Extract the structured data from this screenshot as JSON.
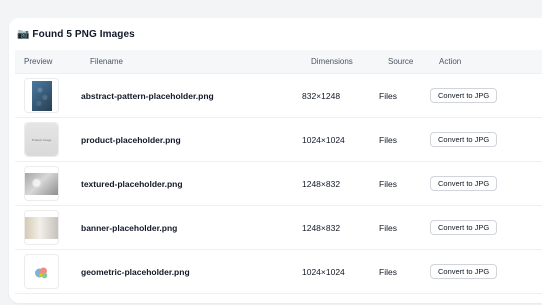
{
  "header": {
    "title": "📷 Found 5 PNG Images"
  },
  "table": {
    "columns": [
      "Preview",
      "Filename",
      "Dimensions",
      "Source",
      "Action"
    ],
    "rows": [
      {
        "preview_icon": "abstract-pattern-thumbnail",
        "filename": "abstract-pattern-placeholder.png",
        "dimensions": "832×1248",
        "source": "Files",
        "action": "Convert to JPG"
      },
      {
        "preview_icon": "product-thumbnail",
        "preview_text": "Product Image",
        "filename": "product-placeholder.png",
        "dimensions": "1024×1024",
        "source": "Files",
        "action": "Convert to JPG"
      },
      {
        "preview_icon": "textured-thumbnail",
        "filename": "textured-placeholder.png",
        "dimensions": "1248×832",
        "source": "Files",
        "action": "Convert to JPG"
      },
      {
        "preview_icon": "banner-thumbnail",
        "filename": "banner-placeholder.png",
        "dimensions": "1248×832",
        "source": "Files",
        "action": "Convert to JPG"
      },
      {
        "preview_icon": "geometric-thumbnail",
        "filename": "geometric-placeholder.png",
        "dimensions": "1024×1024",
        "source": "Files",
        "action": "Convert to JPG"
      }
    ]
  },
  "colors": {
    "page_bg": "#f3f4f6",
    "card_bg": "#ffffff",
    "header_bg": "#f6f7f9",
    "border": "#eceff3",
    "text": "#111827",
    "muted": "#4b5563"
  }
}
